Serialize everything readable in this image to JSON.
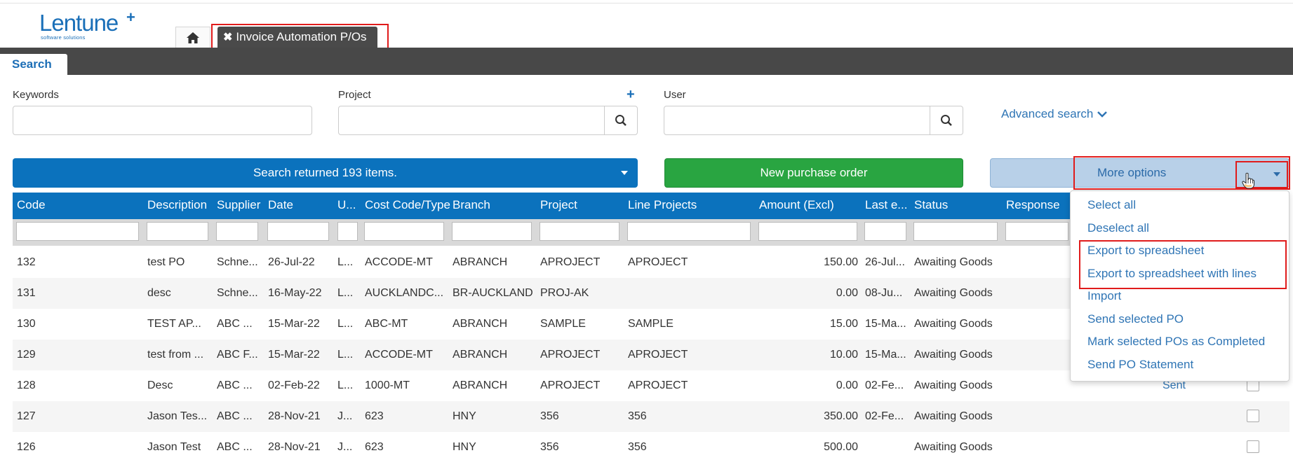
{
  "logo": {
    "name": "Lentune",
    "tagline": "software solutions"
  },
  "tabs": {
    "active_label": "Invoice Automation P/Os",
    "search_tab": "Search"
  },
  "search": {
    "keywords_label": "Keywords",
    "project_label": "Project",
    "user_label": "User",
    "advanced": "Advanced search"
  },
  "actions": {
    "results": "Search returned 193 items.",
    "new_po": "New purchase order",
    "more_options": "More options"
  },
  "table": {
    "columns": [
      "Code",
      "Description",
      "Supplier",
      "Date",
      "U...",
      "Cost Code/Type",
      "Branch",
      "Project",
      "Line Projects",
      "Amount (Excl)",
      "Last e...",
      "Status",
      "Response"
    ],
    "rows": [
      {
        "code": "132",
        "desc": "test PO",
        "supplier": "Schne...",
        "date": "26-Jul-22",
        "u": "L...",
        "cost": "ACCODE-MT",
        "branch": "ABRANCH",
        "project": "APROJECT",
        "line": "APROJECT",
        "amount": "150.00",
        "last": "26-Jul...",
        "status": "Awaiting Goods",
        "response": ""
      },
      {
        "code": "131",
        "desc": "desc",
        "supplier": "Schne...",
        "date": "16-May-22",
        "u": "L...",
        "cost": "AUCKLANDC...",
        "branch": "BR-AUCKLAND",
        "project": "PROJ-AK",
        "line": "",
        "amount": "0.00",
        "last": "08-Ju...",
        "status": "Awaiting Goods",
        "response": ""
      },
      {
        "code": "130",
        "desc": "TEST AP...",
        "supplier": "ABC ...",
        "date": "15-Mar-22",
        "u": "L...",
        "cost": "ABC-MT",
        "branch": "ABRANCH",
        "project": "SAMPLE",
        "line": "SAMPLE",
        "amount": "15.00",
        "last": "15-Ma...",
        "status": "Awaiting Goods",
        "response": ""
      },
      {
        "code": "129",
        "desc": "test from ...",
        "supplier": "ABC F...",
        "date": "15-Mar-22",
        "u": "L...",
        "cost": "ACCODE-MT",
        "branch": "ABRANCH",
        "project": "APROJECT",
        "line": "APROJECT",
        "amount": "10.00",
        "last": "15-Ma...",
        "status": "Awaiting Goods",
        "response": ""
      },
      {
        "code": "128",
        "desc": "Desc",
        "supplier": "ABC ...",
        "date": "02-Feb-22",
        "u": "L...",
        "cost": "1000-MT",
        "branch": "ABRANCH",
        "project": "APROJECT",
        "line": "APROJECT",
        "amount": "0.00",
        "last": "02-Fe...",
        "status": "Awaiting Goods",
        "response": "Sent"
      },
      {
        "code": "127",
        "desc": "Jason Tes...",
        "supplier": "ABC ...",
        "date": "28-Nov-21",
        "u": "J...",
        "cost": "623",
        "branch": "HNY",
        "project": "356",
        "line": "356",
        "amount": "350.00",
        "last": "02-Fe...",
        "status": "Awaiting Goods",
        "response": ""
      },
      {
        "code": "126",
        "desc": "Jason Test",
        "supplier": "ABC ...",
        "date": "28-Nov-21",
        "u": "J...",
        "cost": "623",
        "branch": "HNY",
        "project": "356",
        "line": "356",
        "amount": "500.00",
        "last": "",
        "status": "Awaiting Goods",
        "response": ""
      }
    ]
  },
  "menu": {
    "items": [
      "Select all",
      "Deselect all",
      "Export to spreadsheet",
      "Export to spreadsheet with lines",
      "Import",
      "Send selected PO",
      "Mark selected POs as Completed",
      "Send PO Statement"
    ]
  }
}
